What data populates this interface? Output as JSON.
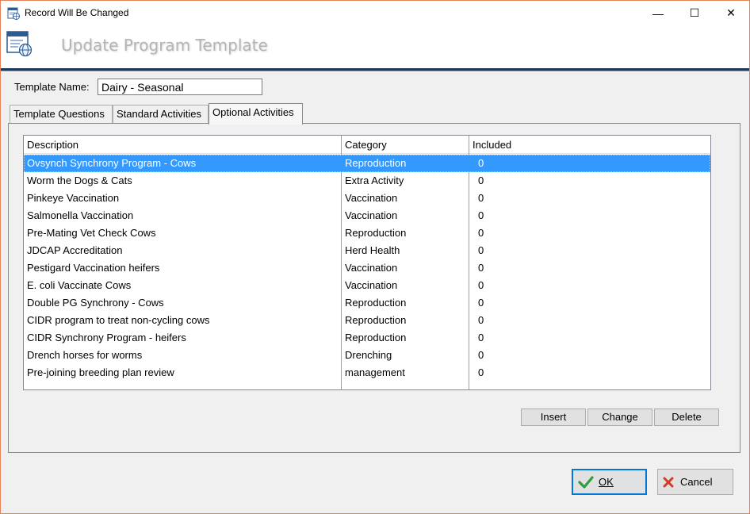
{
  "window": {
    "title": "Record Will Be Changed",
    "minimize_label": "—",
    "maximize_label": "☐",
    "close_label": "✕"
  },
  "header": {
    "heading": "Update Program Template"
  },
  "form": {
    "template_name_label": "Template Name:",
    "template_name_value": "Dairy - Seasonal"
  },
  "tabs": [
    {
      "label": "Template Questions",
      "active": false
    },
    {
      "label": "Standard Activities",
      "active": false
    },
    {
      "label": "Optional Activities",
      "active": true
    }
  ],
  "grid": {
    "columns": [
      "Description",
      "Category",
      "Included"
    ],
    "rows": [
      [
        "Ovsynch Synchrony Program - Cows",
        "Reproduction",
        "0"
      ],
      [
        "Worm the Dogs & Cats",
        "Extra Activity",
        "0"
      ],
      [
        "Pinkeye Vaccination",
        "Vaccination",
        "0"
      ],
      [
        "Salmonella Vaccination",
        "Vaccination",
        "0"
      ],
      [
        "Pre-Mating Vet Check Cows",
        "Reproduction",
        "0"
      ],
      [
        "JDCAP Accreditation",
        "Herd Health",
        "0"
      ],
      [
        "Pestigard Vaccination heifers",
        "Vaccination",
        "0"
      ],
      [
        "E. coli Vaccinate Cows",
        "Vaccination",
        "0"
      ],
      [
        "Double PG Synchrony - Cows",
        "Reproduction",
        "0"
      ],
      [
        "CIDR program to treat non-cycling cows",
        "Reproduction",
        "0"
      ],
      [
        "CIDR Synchrony Program - heifers",
        "Reproduction",
        "0"
      ],
      [
        "Drench horses for worms",
        "Drenching",
        "0"
      ],
      [
        "Pre-joining breeding plan review",
        "management",
        "0"
      ]
    ],
    "selected_row": 0
  },
  "actions": {
    "insert_label": "Insert",
    "change_label": "Change",
    "delete_label": "Delete"
  },
  "dialog": {
    "ok_label": "OK",
    "cancel_label": "Cancel"
  },
  "colors": {
    "selection": "#3399ff",
    "window_border": "#e8825a",
    "header_rule": "#1d3a5c",
    "ok_check": "#2e9e3a",
    "cancel_x": "#d23a2a"
  }
}
